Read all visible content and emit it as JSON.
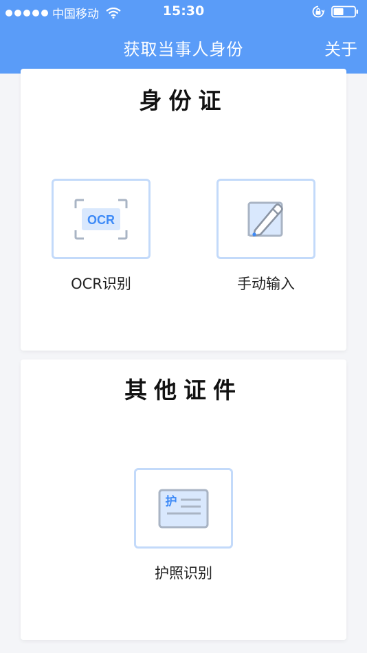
{
  "status_bar": {
    "carrier": "中国移动",
    "time": "15:30"
  },
  "nav": {
    "title": "获取当事人身份",
    "about": "关于"
  },
  "id_card_section": {
    "title": "身份证",
    "options": [
      {
        "label": "OCR识别",
        "icon": "ocr-scan-icon",
        "icon_text": "OCR"
      },
      {
        "label": "手动输入",
        "icon": "manual-edit-icon"
      }
    ]
  },
  "other_section": {
    "title": "其他证件",
    "options": [
      {
        "label": "护照识别",
        "icon": "passport-icon",
        "icon_text": "护"
      }
    ]
  },
  "colors": {
    "header_bg": "#5a9cf8",
    "accent": "#3d8af7",
    "icon_border": "#c3dafa"
  }
}
